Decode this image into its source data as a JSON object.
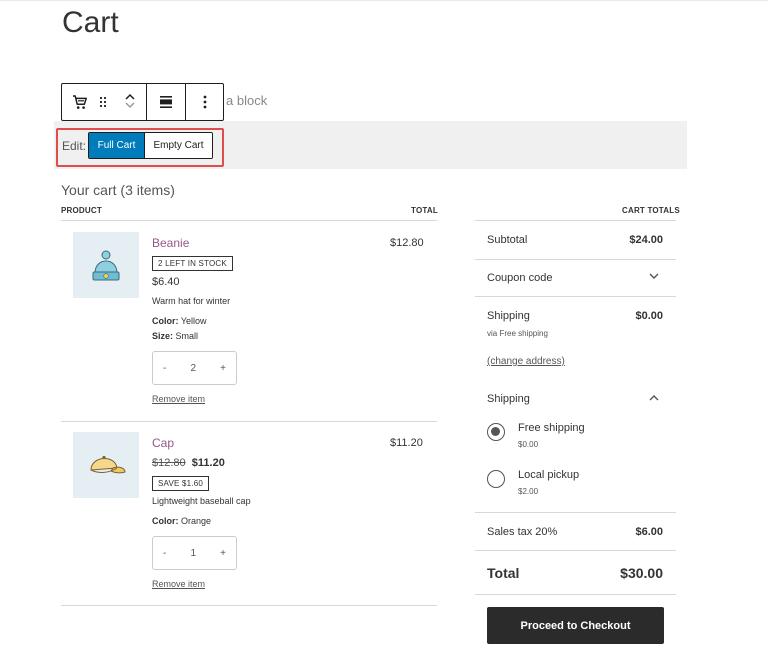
{
  "page": {
    "title": "Cart"
  },
  "toolbar": {
    "icons": [
      "cart-icon",
      "drag-handle-icon",
      "move-up-icon",
      "move-down-icon",
      "align-icon",
      "more-options-icon"
    ],
    "behind_text": "a block"
  },
  "edit": {
    "label": "Edit:",
    "options": [
      "Full Cart",
      "Empty Cart"
    ],
    "selected": "Full Cart",
    "highlight_color": "#e04d4d",
    "selected_color": "#007cba"
  },
  "cart": {
    "heading": "Your cart (3 items)",
    "columns": {
      "product": "PRODUCT",
      "total": "TOTAL"
    },
    "items": [
      {
        "name": "Beanie",
        "badge": "2 LEFT IN STOCK",
        "price": "$6.40",
        "description": "Warm hat for winter",
        "attributes": [
          {
            "key": "Color:",
            "value": "Yellow"
          },
          {
            "key": "Size:",
            "value": "Small"
          }
        ],
        "quantity": "2",
        "remove_label": "Remove item",
        "line_total": "$12.80"
      },
      {
        "name": "Cap",
        "regular_price": "$12.80",
        "sale_price": "$11.20",
        "badge": "SAVE $1.60",
        "description": "Lightweight baseball cap",
        "attributes": [
          {
            "key": "Color:",
            "value": "Orange"
          }
        ],
        "quantity": "1",
        "remove_label": "Remove item",
        "line_total": "$11.20"
      }
    ],
    "stepper": {
      "minus": "-",
      "plus": "+"
    }
  },
  "totals": {
    "heading": "CART TOTALS",
    "subtotal_label": "Subtotal",
    "subtotal_value": "$24.00",
    "coupon_label": "Coupon code",
    "shipping_label": "Shipping",
    "shipping_value": "$0.00",
    "shipping_via": "via Free shipping",
    "change_address": "(change address)",
    "shipping_section_label": "Shipping",
    "options": [
      {
        "label": "Free shipping",
        "price": "$0.00",
        "selected": true
      },
      {
        "label": "Local pickup",
        "price": "$2.00",
        "selected": false
      }
    ],
    "tax_label": "Sales tax 20%",
    "tax_value": "$6.00",
    "total_label": "Total",
    "total_value": "$30.00",
    "checkout_label": "Proceed to Checkout"
  }
}
